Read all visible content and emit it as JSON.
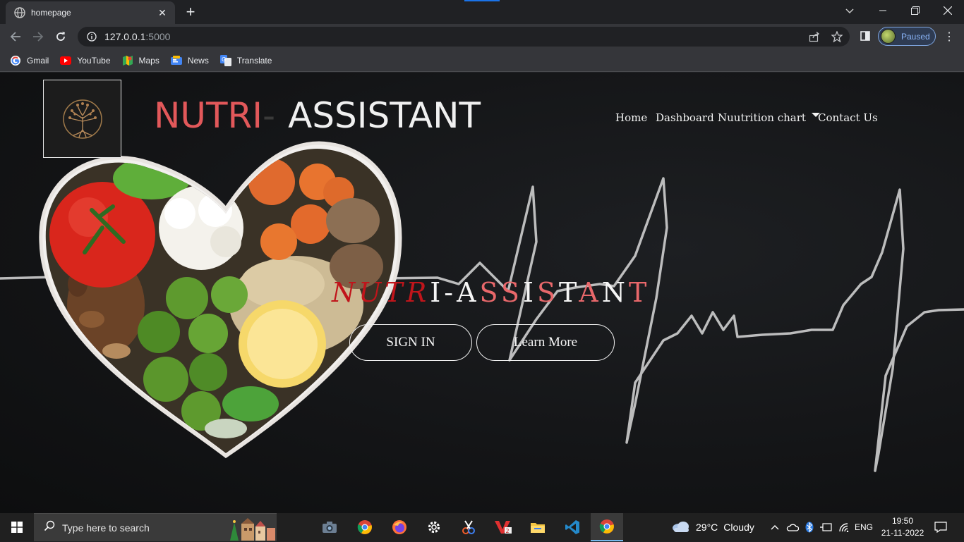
{
  "browser": {
    "tab": {
      "title": "homepage",
      "close_icon": "close-icon",
      "favicon": "globe-icon"
    },
    "new_tab_label": "+",
    "address": {
      "host": "127.0.0.1",
      "port": ":5000"
    },
    "profile": {
      "status": "Paused"
    },
    "bookmarks": [
      {
        "label": "Gmail",
        "icon": "google-icon"
      },
      {
        "label": "YouTube",
        "icon": "youtube-icon"
      },
      {
        "label": "Maps",
        "icon": "maps-icon"
      },
      {
        "label": "News",
        "icon": "news-icon"
      },
      {
        "label": "Translate",
        "icon": "translate-icon"
      }
    ]
  },
  "site": {
    "brand": {
      "part1": "NUTRI",
      "separator": "-",
      "part2": "ASSISTANT"
    },
    "nav": [
      {
        "label": "Home"
      },
      {
        "label": "Dashboard"
      },
      {
        "label": "Nuutrition chart",
        "has_dropdown": true
      },
      {
        "label": "Contact Us"
      }
    ],
    "hero": {
      "title_red": "NUTR",
      "title_white": "I-A",
      "title_pink1": "SS",
      "title_white2": "I",
      "title_pink2": "S",
      "title_white3": "T",
      "title_pink3": "A",
      "title_white4": "N",
      "title_pink4": "T"
    },
    "buttons": {
      "signin": "SIGN IN",
      "learn_more": "Learn More"
    },
    "colors": {
      "brand_red": "#e2585a",
      "hero_red": "#c0151b",
      "text_light": "#f0f0f0"
    }
  },
  "taskbar": {
    "search_placeholder": "Type here to search",
    "weather": {
      "temp": "29°C",
      "condition": "Cloudy"
    },
    "language": "ENG",
    "clock": {
      "time": "19:50",
      "date": "21-11-2022"
    }
  }
}
